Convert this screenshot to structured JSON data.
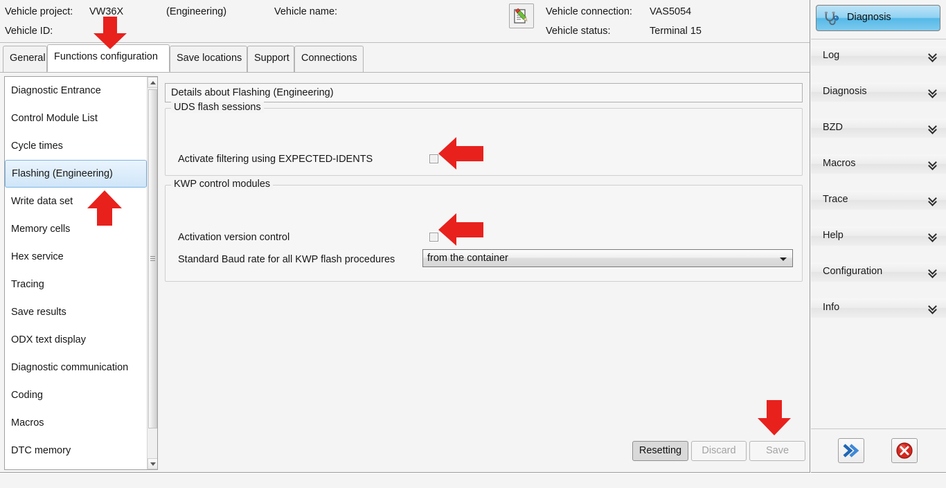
{
  "header": {
    "project_label": "Vehicle project:",
    "project_value": "VW36X",
    "engineering": "(Engineering)",
    "name_label": "Vehicle name:",
    "name_value": "",
    "id_label": "Vehicle ID:",
    "id_value": "",
    "connection_label": "Vehicle connection:",
    "connection_value": "VAS5054",
    "status_label": "Vehicle status:",
    "status_value": "Terminal 15",
    "notepad_icon": "notepad-pencil-icon"
  },
  "tabs": [
    {
      "label": "General",
      "selected": false
    },
    {
      "label": "Functions configuration",
      "selected": true
    },
    {
      "label": "Save locations",
      "selected": false
    },
    {
      "label": "Support",
      "selected": false
    },
    {
      "label": "Connections",
      "selected": false
    }
  ],
  "module_list": [
    {
      "label": "Diagnostic Entrance",
      "selected": false
    },
    {
      "label": "Control Module List",
      "selected": false
    },
    {
      "label": "Cycle times",
      "selected": false
    },
    {
      "label": "Flashing (Engineering)",
      "selected": true
    },
    {
      "label": "Write data set",
      "selected": false
    },
    {
      "label": "Memory cells",
      "selected": false
    },
    {
      "label": "Hex service",
      "selected": false
    },
    {
      "label": "Tracing",
      "selected": false
    },
    {
      "label": "Save results",
      "selected": false
    },
    {
      "label": "ODX text display",
      "selected": false
    },
    {
      "label": "Diagnostic communication",
      "selected": false
    },
    {
      "label": "Coding",
      "selected": false
    },
    {
      "label": "Macros",
      "selected": false
    },
    {
      "label": "DTC memory",
      "selected": false
    }
  ],
  "detail": {
    "title": "Details about Flashing (Engineering)",
    "uds_group_legend": "UDS flash sessions",
    "uds_filter_label": "Activate filtering using EXPECTED-IDENTS",
    "uds_filter_checked": false,
    "kwp_group_legend": "KWP control modules",
    "kwp_version_label": "Activation version control",
    "kwp_version_checked": false,
    "kwp_baud_label": "Standard Baud rate for all KWP flash procedures",
    "kwp_baud_value": "from the container"
  },
  "actions": {
    "resetting_label": "Resetting",
    "discard_label": "Discard",
    "save_label": "Save"
  },
  "sidebar": {
    "diagnosis_button_label": "Diagnosis",
    "diagnosis_icon": "stethoscope-icon",
    "sections": [
      {
        "label": "Log"
      },
      {
        "label": "Diagnosis"
      },
      {
        "label": "BZD"
      },
      {
        "label": "Macros"
      },
      {
        "label": "Trace"
      },
      {
        "label": "Help"
      },
      {
        "label": "Configuration"
      },
      {
        "label": "Info"
      }
    ],
    "forward_icon": "double-chevron-right-icon",
    "close_icon": "red-close-x-icon"
  },
  "colors": {
    "accent_blue": "#55b9e8",
    "annotation_red": "#e8211d",
    "selection_blue": "#cfe6f9",
    "panel_gray": "#f4f4f4"
  },
  "annotations": {
    "arrow_count": 5,
    "arrow_color": "#e8211d",
    "targets": [
      "functions-configuration-tab",
      "flashing-engineering-list-item",
      "uds-filter-checkbox",
      "kwp-version-checkbox",
      "save-button"
    ]
  }
}
